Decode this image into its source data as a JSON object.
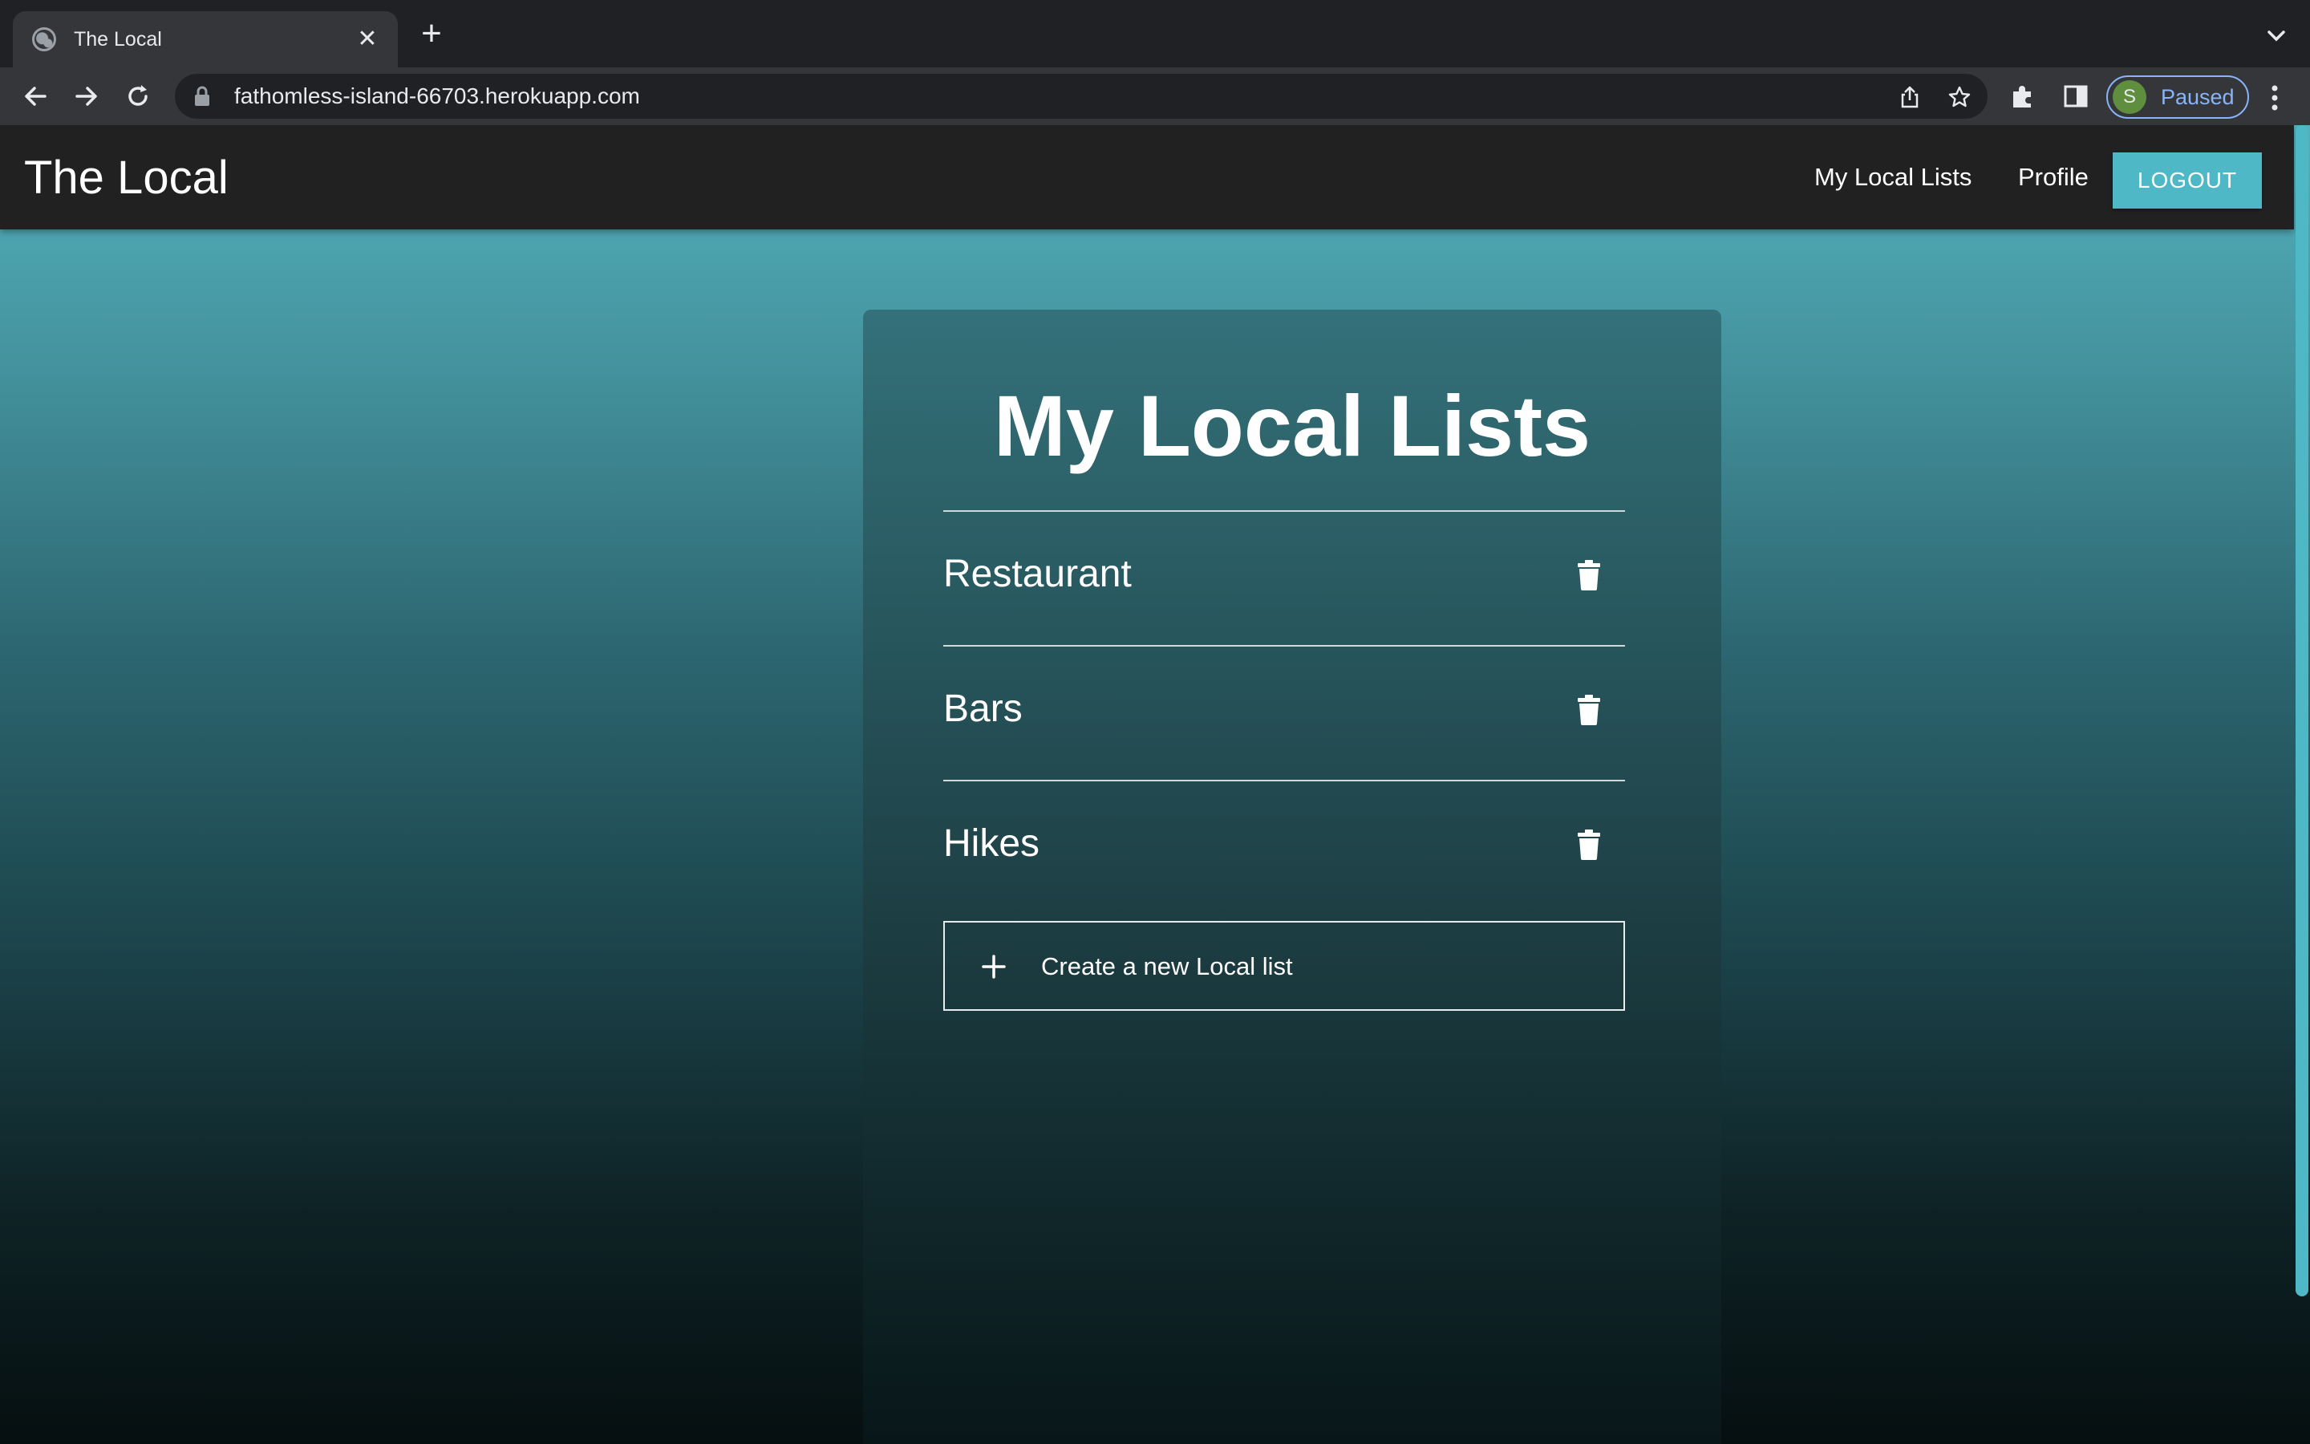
{
  "browser": {
    "tab_title": "The Local",
    "tab_close": "✕",
    "new_tab": "+",
    "url": "fathomless-island-66703.herokuapp.com",
    "profile_initial": "S",
    "profile_status": "Paused",
    "colors": {
      "chrome_dark": "#202124",
      "chrome_toolbar": "#35363a",
      "accent": "#8ab4f8"
    }
  },
  "navbar": {
    "brand": "The Local",
    "links": [
      "My Local Lists",
      "Profile"
    ],
    "logout_label": "LOGOUT",
    "colors": {
      "background": "#212121",
      "button": "#4fb8c7"
    }
  },
  "main": {
    "title": "My Local Lists",
    "lists": [
      {
        "label": "Restaurant",
        "icon": "trash-icon"
      },
      {
        "label": "Bars",
        "icon": "trash-icon"
      },
      {
        "label": "Hikes",
        "icon": "trash-icon"
      }
    ],
    "create_label": "Create a new Local list",
    "create_icon": "plus-icon"
  }
}
